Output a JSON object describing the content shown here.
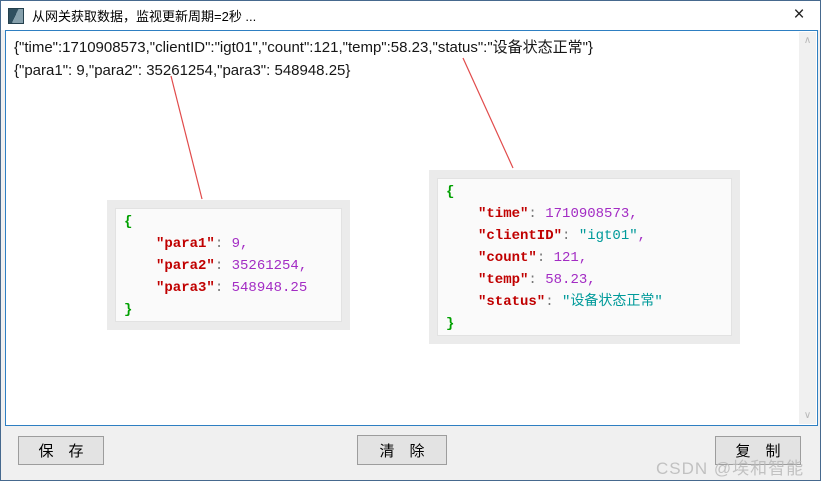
{
  "window": {
    "title": "从网关获取数据，监视更新周期=2秒 ...",
    "close_glyph": "×"
  },
  "raw_output": {
    "line1": "{\"time\":1710908573,\"clientID\":\"igt01\",\"count\":121,\"temp\":58.23,\"status\":\"设备状态正常\"}",
    "line2": "{\"para1\": 9,\"para2\": 35261254,\"para3\": 548948.25}"
  },
  "card_left": {
    "brace_open": "{",
    "brace_close": "}",
    "rows": [
      {
        "key": "\"para1\"",
        "sep": ": ",
        "val": "9",
        "comma": ","
      },
      {
        "key": "\"para2\"",
        "sep": ": ",
        "val": "35261254",
        "comma": ","
      },
      {
        "key": "\"para3\"",
        "sep": ": ",
        "val": "548948.25",
        "comma": ""
      }
    ]
  },
  "card_right": {
    "brace_open": "{",
    "brace_close": "}",
    "rows": [
      {
        "key": "\"time\"",
        "sep": ": ",
        "val": "1710908573",
        "comma": ","
      },
      {
        "key": "\"clientID\"",
        "sep": ": ",
        "val": "\"igt01\"",
        "comma": ","
      },
      {
        "key": "\"count\"",
        "sep": ": ",
        "val": "121",
        "comma": ","
      },
      {
        "key": "\"temp\"",
        "sep": ": ",
        "val": "58.23",
        "comma": ","
      },
      {
        "key": "\"status\"",
        "sep": ": ",
        "val": "\"设备状态正常\"",
        "comma": ""
      }
    ]
  },
  "scrollbar": {
    "up_glyph": "∧",
    "down_glyph": "∨"
  },
  "buttons": {
    "save": "保　存",
    "clear": "清　除",
    "copy": "复　制"
  },
  "watermark": "CSDN @埃和智能",
  "colors": {
    "viewer_border": "#2e7fc2",
    "json_key": "#c00000",
    "json_number": "#a32cc4",
    "json_string": "#009a9a",
    "json_brace": "#00a000",
    "annotation_line": "#e14b4b",
    "card_background": "#ebebeb",
    "button_background": "#e3e3e3"
  }
}
